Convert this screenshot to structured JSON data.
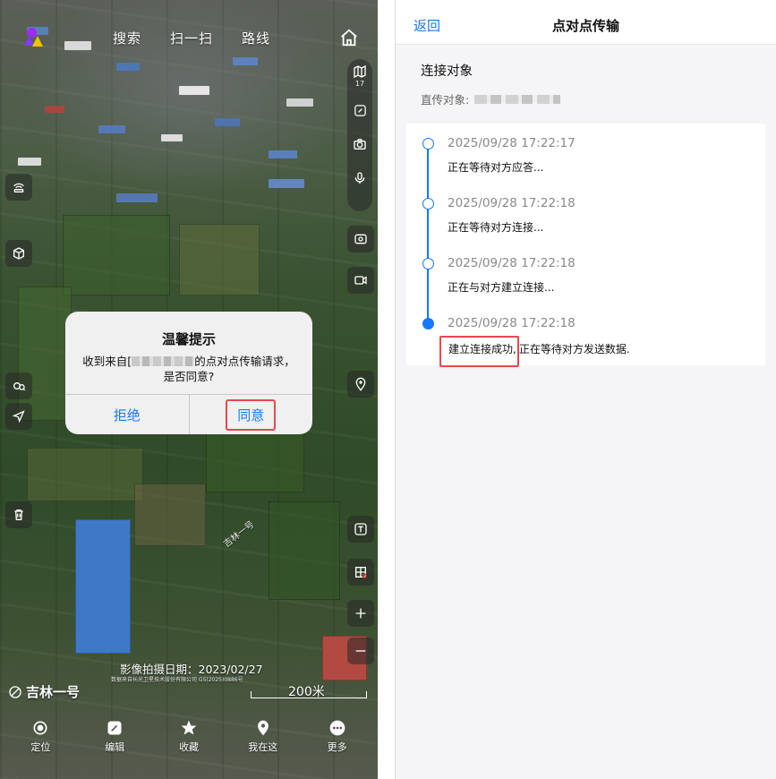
{
  "map_screen": {
    "top_bar": {
      "links": [
        "搜索",
        "扫一扫",
        "路线"
      ]
    },
    "side_toolbar": {
      "layer_badge_number": "17"
    },
    "dialog": {
      "title": "温馨提示",
      "message_prefix": "收到来自[",
      "message_suffix": "的点对点传输请求，是否同意?",
      "reject_label": "拒绝",
      "agree_label": "同意"
    },
    "imagery_date": "影像拍摄日期：2023/02/27",
    "imagery_credit": "数据来自长光卫星技术股份有限公司 GS(2025)0886号",
    "road_label": "吉林一号",
    "scale_label": "200米",
    "brand_label": "吉林一号",
    "bottom_nav": [
      "定位",
      "编辑",
      "收藏",
      "我在这",
      "更多"
    ]
  },
  "transfer_screen": {
    "back_label": "返回",
    "title": "点对点传输",
    "section_title": "连接对象",
    "direct_label": "直传对象:",
    "timeline": [
      {
        "time": "2025/09/28 17:22:17",
        "status": "正在等待对方应答...",
        "active": false
      },
      {
        "time": "2025/09/28 17:22:18",
        "status": "正在等待对方连接...",
        "active": false
      },
      {
        "time": "2025/09/28 17:22:18",
        "status": "正在与对方建立连接...",
        "active": false
      },
      {
        "time": "2025/09/28 17:22:18",
        "status_highlight": "建立连接成功,",
        "status_rest": "正在等待对方发送数据.",
        "active": true
      }
    ]
  },
  "colors": {
    "accent_blue": "#1677ff",
    "highlight_red": "#e8474f"
  }
}
